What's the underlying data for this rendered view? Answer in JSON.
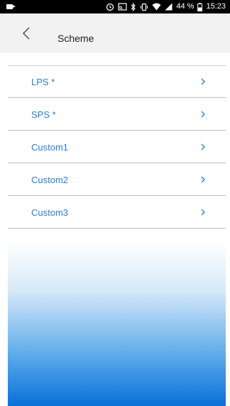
{
  "status_bar": {
    "battery_percent": "44 %",
    "time": "15:23",
    "icons": [
      "video-icon",
      "alarm-icon",
      "cast-icon",
      "bluetooth-icon",
      "vibrate-icon",
      "wifi-icon",
      "signal-icon",
      "battery-icon"
    ]
  },
  "header": {
    "title": "Scheme",
    "back_icon": "chevron-left-icon"
  },
  "schemes": [
    {
      "label": "LPS *"
    },
    {
      "label": "SPS *"
    },
    {
      "label": "Custom1"
    },
    {
      "label": "Custom2"
    },
    {
      "label": "Custom3"
    }
  ],
  "colors": {
    "accent": "#2b7bd6",
    "header_bg": "#f2f2f2",
    "gradient_bottom": "#0a6fd8"
  }
}
